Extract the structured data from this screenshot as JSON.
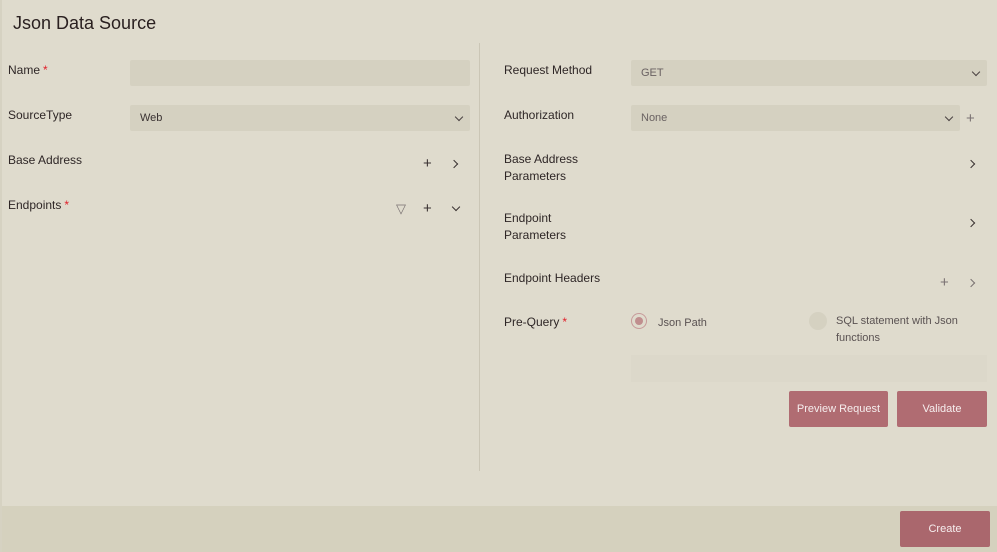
{
  "dialog": {
    "title": "Json Data Source"
  },
  "left": {
    "name": {
      "label": "Name",
      "required": true,
      "value": "",
      "placeholder": ""
    },
    "source_type": {
      "label": "SourceType",
      "value": "Web"
    },
    "base_address": {
      "label": "Base Address"
    },
    "endpoints": {
      "label": "Endpoints",
      "required": true
    }
  },
  "right": {
    "request_method": {
      "label": "Request Method",
      "value": "GET"
    },
    "authorization": {
      "label": "Authorization",
      "value": "None"
    },
    "base_address_parameters": {
      "label_line1": "Base Address",
      "label_line2": "Parameters"
    },
    "endpoint_parameters": {
      "label_line1": "Endpoint",
      "label_line2": "Parameters"
    },
    "endpoint_headers": {
      "label": "Endpoint Headers"
    },
    "pre_query": {
      "label": "Pre-Query",
      "required": true,
      "options": [
        {
          "label": "Json Path",
          "selected": true
        },
        {
          "label_line1": "SQL statement with Json",
          "label_line2": "functions",
          "selected": false
        }
      ],
      "value": ""
    },
    "buttons": {
      "preview": "Preview Request",
      "validate": "Validate"
    }
  },
  "required_marker": "*",
  "icons": {
    "plus": "+",
    "filter": "▽"
  },
  "footer": {
    "create": "Create"
  },
  "colors": {
    "accent": "#b06c72",
    "required": "#e0202a",
    "background": "#dfdbcd",
    "field": "#d5d1c1"
  }
}
